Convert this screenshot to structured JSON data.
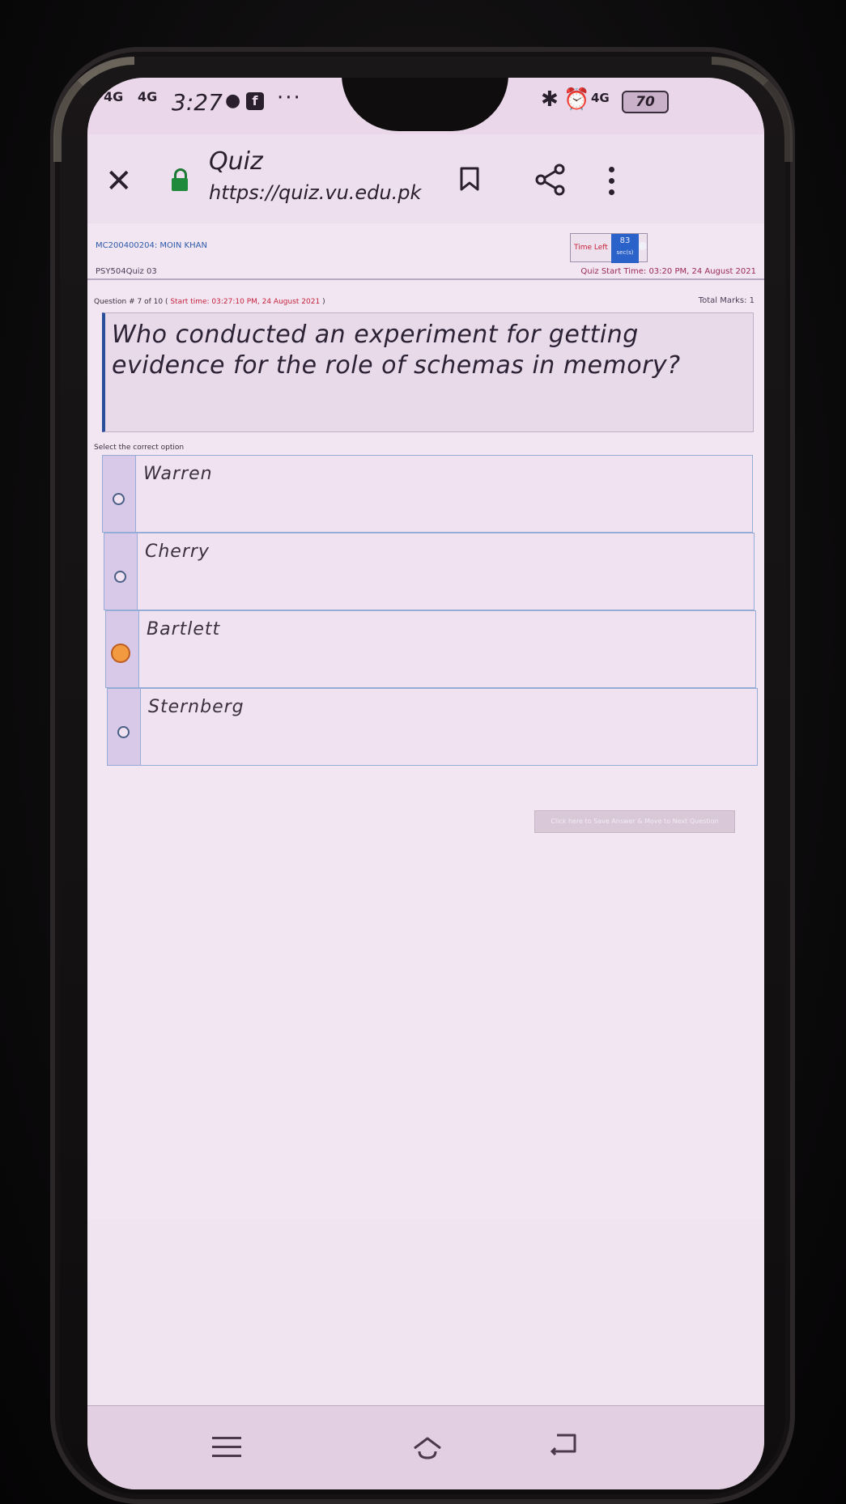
{
  "status_bar": {
    "signal_1": "4G",
    "signal_2": "4G",
    "time": "3:27",
    "more": "···",
    "network": "4G",
    "battery": "70"
  },
  "browser": {
    "close_icon": "close-icon",
    "title": "Quiz",
    "url": "https://quiz.vu.edu.pk"
  },
  "header": {
    "student": "MC200400204: MOIN KHAN",
    "quiz_code": "PSY504Quiz 03",
    "time_left_label": "Time Left",
    "time_left_value": "83",
    "time_left_unit": "sec(s)",
    "quiz_start": "Quiz Start Time: 03:20 PM, 24 August 2021"
  },
  "question": {
    "meta_prefix": "Question # 7 of 10 (",
    "meta_start": "Start time: 03:27:10 PM, 24 August 2021",
    "meta_suffix": ")",
    "total_marks": "Total Marks: 1",
    "text": "Who conducted an experiment for getting evidence for the role of schemas in memory?",
    "select_label": "Select the correct option"
  },
  "options": [
    {
      "label": "Warren",
      "selected": false
    },
    {
      "label": "Cherry",
      "selected": false
    },
    {
      "label": "Bartlett",
      "selected": true
    },
    {
      "label": "Sternberg",
      "selected": false
    }
  ],
  "submit_label": "Click here to Save Answer & Move to Next Question"
}
